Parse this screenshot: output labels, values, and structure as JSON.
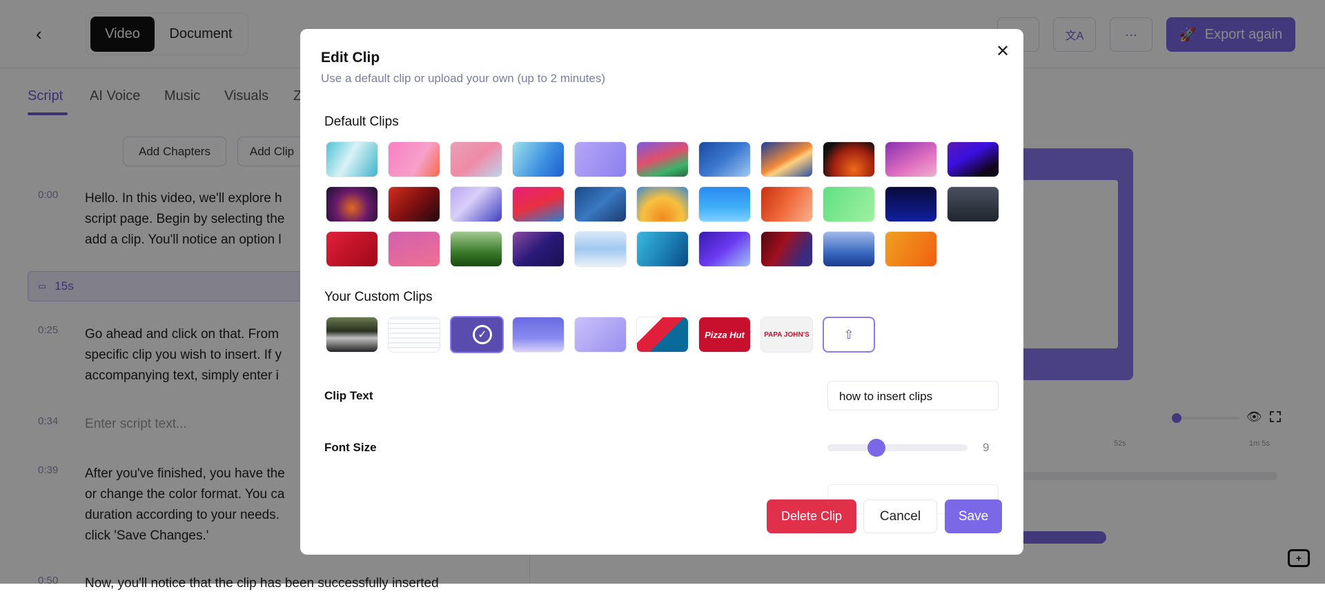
{
  "header": {
    "mode_tabs": [
      "Video",
      "Document"
    ],
    "export_label": "Export again"
  },
  "tabs": [
    "Script",
    "AI Voice",
    "Music",
    "Visuals",
    "Z"
  ],
  "toolbar": {
    "add_chapters": "Add Chapters",
    "add_clip": "Add Clip"
  },
  "script": {
    "rows": [
      {
        "time": "0:00",
        "lines": [
          "Hello. In this video, we'll explore h",
          "script page. Begin by selecting the",
          "add a clip. You'll notice an option l"
        ]
      },
      {
        "time": "0:25",
        "lines": [
          "Go ahead and click on that. From",
          "specific clip you wish to insert. If y",
          "accompanying text, simply enter i"
        ]
      },
      {
        "time": "0:34",
        "placeholder": "Enter script text..."
      },
      {
        "time": "0:39",
        "lines": [
          "After you've finished, you have the",
          "or change the color format. You ca",
          "duration according to your needs.",
          "click 'Save Changes.'"
        ]
      },
      {
        "time": "0:50",
        "lines": [
          "Now, you'll notice that the clip has been successfully inserted"
        ]
      }
    ],
    "clip_duration": "15s"
  },
  "preview": {
    "ticks": [
      "52s",
      "1m 5s"
    ],
    "zoom_level": 0.05
  },
  "modal": {
    "title": "Edit Clip",
    "subtitle": "Use a default clip or upload your own (up to 2 minutes)",
    "default_section": "Default Clips",
    "custom_section": "Your Custom Clips",
    "clip_text_label": "Clip Text",
    "clip_text_value": "how to insert clips",
    "font_size_label": "Font Size",
    "font_size_value": "9",
    "font_size_min": 1,
    "font_size_max": 30,
    "delete_label": "Delete Clip",
    "cancel_label": "Cancel",
    "save_label": "Save",
    "custom_logos": [
      "Pizza Hut",
      "PAPA JOHN'S"
    ],
    "default_clips": [
      "linear-gradient(120deg,#4fc3d6,#d8f2f5 45%,#3fb3cc)",
      "linear-gradient(120deg,#f77fc4,#f7a0c8 60%,#f26a4a)",
      "linear-gradient(140deg,#e6a0b5,#f08aa8 50%,#bcd4ea)",
      "linear-gradient(120deg,#9fe0ea,#3b8fe0 60%,#1e5fd0)",
      "linear-gradient(120deg,#b5a6f5,#8c7ff0)",
      "linear-gradient(160deg,#7b5be0,#e0506a 45%,#3ab36b 75%,#2a6a3a)",
      "linear-gradient(140deg,#1a4aa0,#3c78d0 50%,#a0c8f0)",
      "linear-gradient(150deg,#1c3f9a,#f08a3a 50%,#ffd080 60%,#2a4fa0)",
      "radial-gradient(circle at 60% 80%,#f06a1a,#a02010 50%,#111 80%)",
      "linear-gradient(150deg,#8a2fb0,#e070c0 60%,#f0b0d0)",
      "linear-gradient(150deg,#5a1ab0,#3a10e0 40%,#10051a 80%)",
      "radial-gradient(circle at 50% 60%,#e06a20,#6a1a6a 50%,#1a1030)",
      "linear-gradient(135deg,#d03020,#801010 50%,#200810)",
      "linear-gradient(135deg,#b8a8f5,#d8cff8 40%,#4040c0)",
      "linear-gradient(160deg,#e8207a,#e83040 50%,#2a80d0)",
      "linear-gradient(140deg,#1a4a8a,#3a78c0 50%,#1a3a70)",
      "radial-gradient(circle at 50% 90%,#f08a20,#f8c040 50%,#3a8ad0)",
      "linear-gradient(180deg,#2a8af0,#40b0f8 60%,#80d0ff)",
      "linear-gradient(120deg,#c83010,#f06a3a 50%,#f8b090)",
      "linear-gradient(120deg,#60e080,#a0f0a0)",
      "linear-gradient(180deg,#0a0a3a,#1020a0)",
      "linear-gradient(180deg,#4a5060,#20262e)",
      "linear-gradient(135deg,#e0203a,#a00818)",
      "linear-gradient(160deg,#d060b0,#f07090)",
      "linear-gradient(180deg,#a0c890,#3a7a2a 60%,#1a4a10)",
      "linear-gradient(140deg,#8a4aa0,#2a1a7a 50%,#1a1050)",
      "linear-gradient(180deg,#d8e8f8,#a0c8f0 50%,#e8f0f8)",
      "linear-gradient(120deg,#3ab8e0,#1a7ab0 60%,#0a4a80)",
      "linear-gradient(140deg,#3a1ab0,#6a3af0 50%,#a0c0f8)",
      "linear-gradient(120deg,#500810,#a01020 40%,#3a2a80 80%)",
      "linear-gradient(180deg,#a0b8e8,#3a6ac0 60%,#1a3a90)",
      "linear-gradient(120deg,#f0a020,#f06010)"
    ]
  },
  "colors": {
    "accent": "#6c5ccf",
    "danger": "#e0304a"
  }
}
